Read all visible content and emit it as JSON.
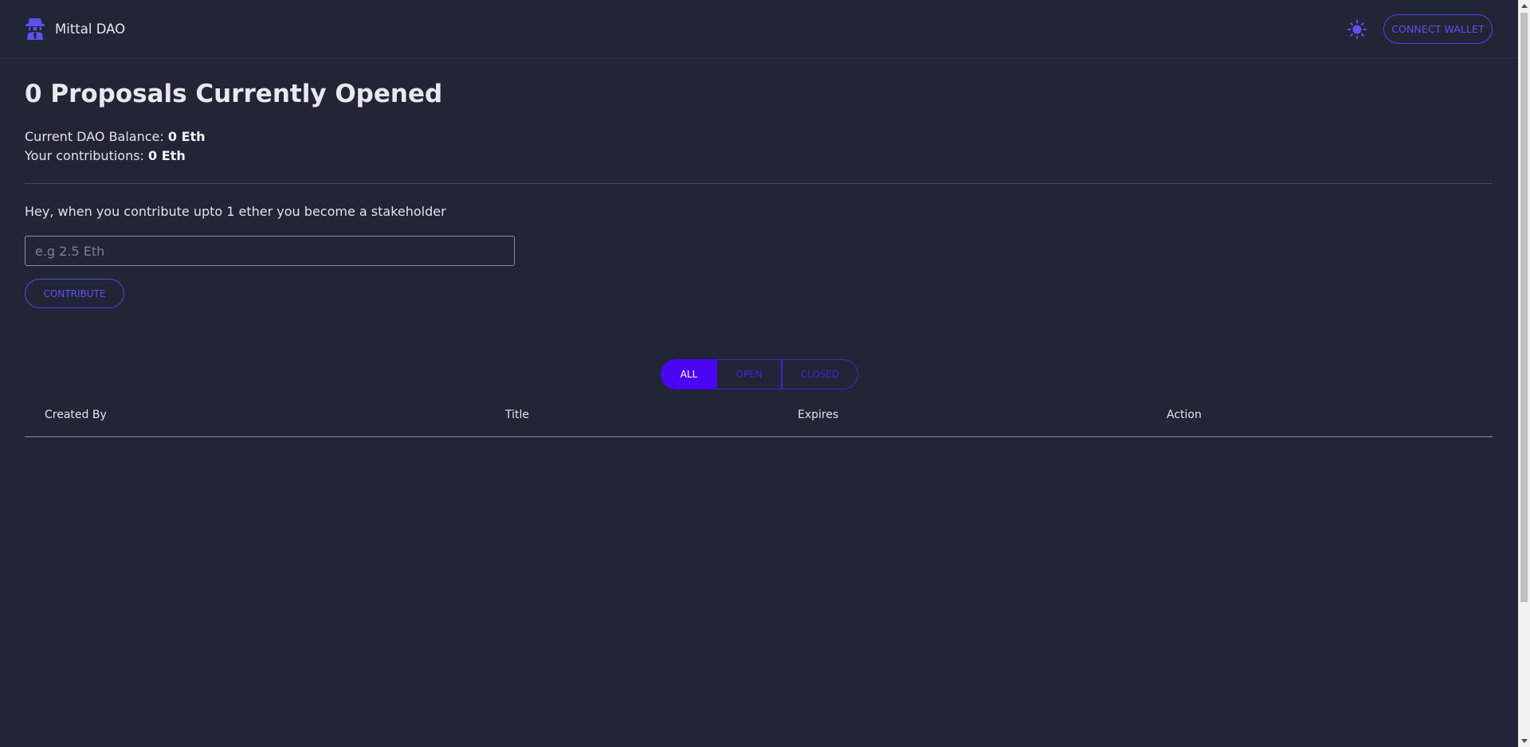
{
  "header": {
    "app_name": "Mittal DAO",
    "logo_icon": "spy-icon",
    "theme_icon": "sun-icon",
    "connect_label": "CONNECT WALLET"
  },
  "main": {
    "title": "0 Proposals Currently Opened",
    "balance_label": "Current DAO Balance: ",
    "balance_value": "0 Eth",
    "contrib_label": "Your contributions: ",
    "contrib_value": "0 Eth",
    "hint": "Hey, when you contribute upto 1 ether you become a stakeholder",
    "amount_placeholder": "e.g 2.5 Eth",
    "contribute_label": "CONTRIBUTE"
  },
  "filters": {
    "all": "ALL",
    "open": "OPEN",
    "closed": "CLOSED",
    "selected": "ALL"
  },
  "table": {
    "columns": [
      "Created By",
      "Title",
      "Expires",
      "Action"
    ],
    "rows": []
  },
  "colors": {
    "background": "#212536",
    "accent": "#4f46e5",
    "active_filter": "#4a06f0"
  }
}
